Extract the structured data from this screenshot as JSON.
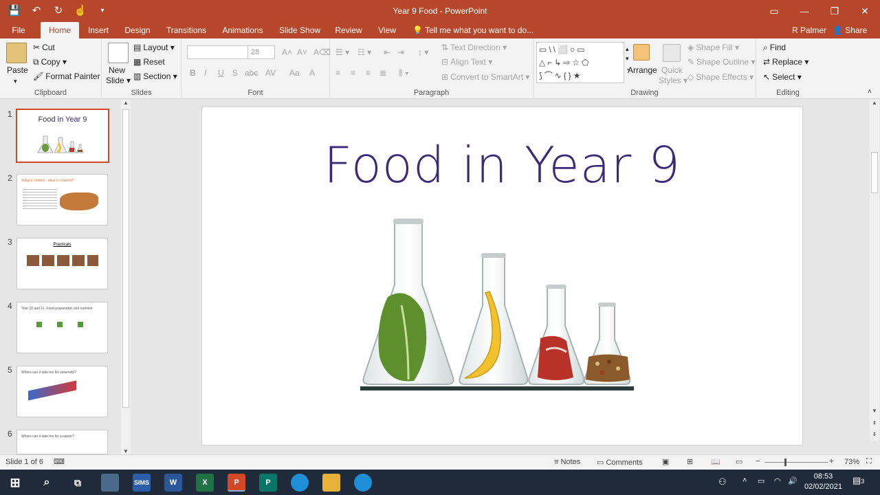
{
  "window": {
    "title": "Year 9 Food - PowerPoint",
    "qat": {
      "save": "save-icon",
      "undo": "undo-icon",
      "redo": "redo-icon",
      "touch": "touch-mode-icon",
      "more": "customize-icon"
    },
    "controls": [
      "ribbon-options-icon",
      "minimize-icon",
      "restore-icon",
      "close-icon"
    ]
  },
  "tabs": [
    {
      "label": "File"
    },
    {
      "label": "Home"
    },
    {
      "label": "Insert"
    },
    {
      "label": "Design"
    },
    {
      "label": "Transitions"
    },
    {
      "label": "Animations"
    },
    {
      "label": "Slide Show"
    },
    {
      "label": "Review"
    },
    {
      "label": "View"
    }
  ],
  "tell_me": "Tell me what you want to do...",
  "user": "R Palmer",
  "share": "Share",
  "ribbon": {
    "clipboard": {
      "label": "Clipboard",
      "paste": "Paste",
      "cut": "Cut",
      "copy": "Copy",
      "format_painter": "Format Painter"
    },
    "slides": {
      "label": "Slides",
      "new_slide_1": "New",
      "new_slide_2": "Slide",
      "layout": "Layout",
      "reset": "Reset",
      "section": "Section"
    },
    "font": {
      "label": "Font",
      "name": "",
      "size": "28"
    },
    "paragraph": {
      "label": "Paragraph",
      "text_direction": "Text Direction",
      "align_text": "Align Text",
      "smartart": "Convert to SmartArt"
    },
    "drawing": {
      "label": "Drawing",
      "arrange": "Arrange",
      "quick_styles_1": "Quick",
      "quick_styles_2": "Styles",
      "shape_fill": "Shape Fill",
      "shape_outline": "Shape Outline",
      "shape_effects": "Shape Effects"
    },
    "editing": {
      "label": "Editing",
      "find": "Find",
      "replace": "Replace",
      "select": "Select"
    }
  },
  "thumbnails": [
    {
      "num": "1",
      "title": "Food in Year 9"
    },
    {
      "num": "2",
      "title": "Subject content - what is covered?"
    },
    {
      "num": "3",
      "title": "Practicals"
    },
    {
      "num": "4",
      "title": "Year 10 and 11- Food preparation and nutrition"
    },
    {
      "num": "5",
      "title": "Where can it take me for university?"
    },
    {
      "num": "6",
      "title": "Where can it take me for a career?"
    }
  ],
  "slide": {
    "title": "Food in Year 9"
  },
  "status": {
    "slide_of": "Slide 1 of 6",
    "notes": "Notes",
    "comments": "Comments",
    "zoom": "73%"
  },
  "taskbar": {
    "time": "08:53",
    "date": "02/02/2021",
    "notif_count": "3"
  }
}
